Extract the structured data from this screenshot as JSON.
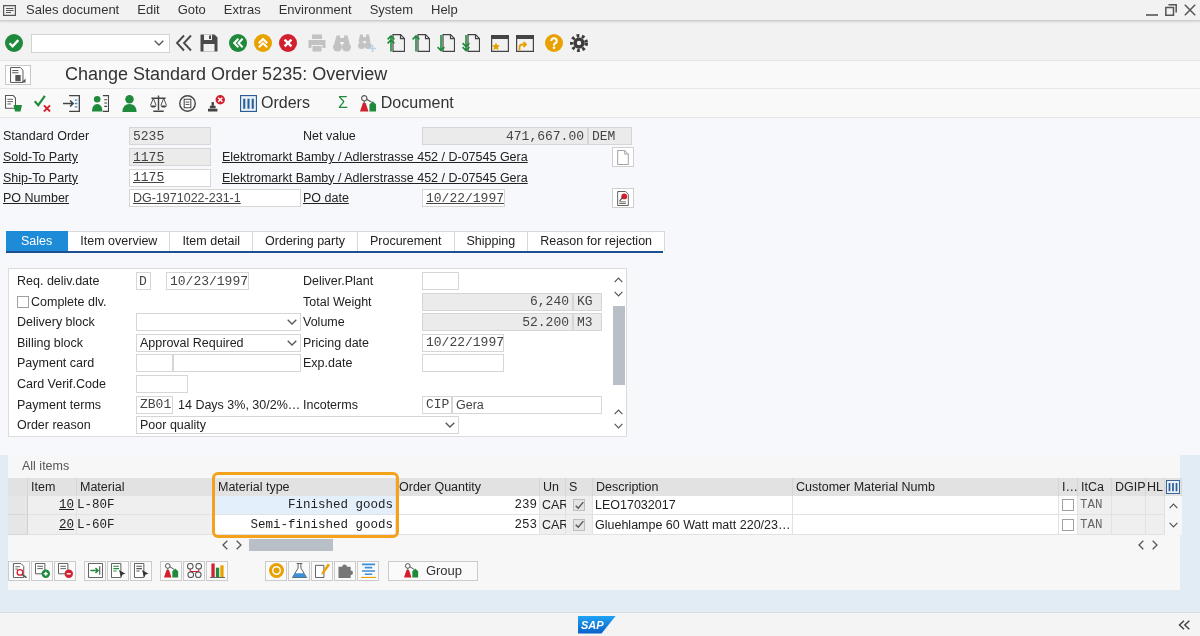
{
  "menu_bar": [
    "Sales document",
    "Edit",
    "Goto",
    "Extras",
    "Environment",
    "System",
    "Help"
  ],
  "system_toolbar": [
    {
      "kind": "enter",
      "disabled": false
    },
    {
      "kind": "collapse",
      "disabled": false
    },
    {
      "kind": "save",
      "disabled": false
    },
    {
      "kind": "back",
      "disabled": false
    },
    {
      "kind": "exit",
      "disabled": false
    },
    {
      "kind": "cancel",
      "disabled": false
    },
    {
      "kind": "print",
      "disabled": true
    },
    {
      "kind": "find",
      "disabled": true
    },
    {
      "kind": "find-next",
      "disabled": true
    },
    {
      "kind": "first-page",
      "disabled": false
    },
    {
      "kind": "previous-page",
      "disabled": false
    },
    {
      "kind": "next-page",
      "disabled": false
    },
    {
      "kind": "last-page",
      "disabled": false
    },
    {
      "kind": "new-session",
      "disabled": false
    },
    {
      "kind": "shortcut",
      "disabled": false
    },
    {
      "kind": "help",
      "disabled": false
    },
    {
      "kind": "customize",
      "disabled": false
    }
  ],
  "title": "Change Standard Order 5235: Overview",
  "application_toolbar": {
    "buttons": [
      {
        "label": "Orders"
      },
      {
        "label": "Σ"
      },
      {
        "label": "Document"
      }
    ]
  },
  "header": [
    {
      "label": "Standard Order",
      "link": false,
      "value": "5235",
      "readonly": true
    },
    {
      "label": "Net value",
      "link": false,
      "value": "471,667.00",
      "unit": "DEM",
      "readonly": true
    },
    {
      "label": "Sold-To Party",
      "link": true,
      "value": "1175",
      "readonly": true,
      "description": "Elektromarkt Bamby / Adlerstrasse 452 / D-07545 Gera"
    },
    {
      "label": "Ship-To Party",
      "link": true,
      "value": "1175",
      "readonly": false,
      "description": "Elektromarkt Bamby / Adlerstrasse 452 / D-07545 Gera"
    },
    {
      "label": "PO Number",
      "link": true,
      "value": "DG-1971022-231-1",
      "readonly": false
    },
    {
      "label": "PO date",
      "link": true,
      "value": "10/22/1997",
      "readonly": false
    }
  ],
  "tabs": [
    {
      "label": "Sales",
      "selected": true
    },
    {
      "label": "Item overview",
      "selected": false
    },
    {
      "label": "Item detail",
      "selected": false
    },
    {
      "label": "Ordering party",
      "selected": false
    },
    {
      "label": "Procurement",
      "selected": false
    },
    {
      "label": "Shipping",
      "selected": false
    },
    {
      "label": "Reason for rejection",
      "selected": false
    }
  ],
  "sales_tab": {
    "left": [
      {
        "label": "Req. deliv.date",
        "values": [
          "D",
          "10/23/1997"
        ],
        "readonly": false
      },
      {
        "label": "Complete dlv.",
        "checked": false
      },
      {
        "label": "Delivery block",
        "readonly": false
      },
      {
        "label": "Billing block",
        "value": "Approval Required",
        "readonly": false
      },
      {
        "label": "Payment card",
        "readonly": false
      },
      {
        "label": "Card Verif.Code",
        "readonly": false
      },
      {
        "label": "Payment terms",
        "values": [
          "ZB01",
          "14 Days 3%, 30/2%…"
        ],
        "readonly": false
      },
      {
        "label": "Order reason",
        "value": "Poor quality",
        "readonly": false
      }
    ],
    "right": [
      {
        "label": "Deliver.Plant",
        "readonly": false
      },
      {
        "label": "Total Weight",
        "value": "6,240",
        "unit": "KG",
        "readonly": true
      },
      {
        "label": "Volume",
        "value": "52.200",
        "unit": "M3",
        "readonly": true
      },
      {
        "label": "Pricing date",
        "value": "10/22/1997",
        "readonly": false
      },
      {
        "label": "Exp.date",
        "readonly": false
      },
      {
        "label": "Incoterms",
        "values": [
          "CIP",
          "Gera"
        ],
        "readonly": false
      }
    ]
  },
  "items": {
    "title": "All items",
    "columns": [
      {
        "label": "Item",
        "editable": false,
        "highlighted": false
      },
      {
        "label": "Material",
        "editable": false,
        "highlighted": false
      },
      {
        "label": "Material type",
        "editable": true,
        "highlighted": true
      },
      {
        "label": "Order Quantity",
        "editable": true,
        "highlighted": false
      },
      {
        "label": "Un",
        "editable": false,
        "highlighted": false
      },
      {
        "label": "S",
        "editable": false,
        "highlighted": false
      },
      {
        "label": "Description",
        "editable": true,
        "highlighted": false
      },
      {
        "label": "Customer Material Numb",
        "editable": true,
        "highlighted": false
      },
      {
        "label": "I…",
        "editable": true,
        "highlighted": false
      },
      {
        "label": "ItCa",
        "editable": false,
        "highlighted": false
      },
      {
        "label": "DGIP",
        "editable": false,
        "highlighted": false
      },
      {
        "label": "HL",
        "editable": false,
        "highlighted": false
      }
    ],
    "rows": [
      {
        "item": "10",
        "material": "L-80F",
        "material_type": "Finished goods",
        "order_quantity": "239",
        "unit": "CAR",
        "s_checked": true,
        "description": "LEO17032017",
        "i_checked": false,
        "itca": "TAN",
        "focused": true
      },
      {
        "item": "20",
        "material": "L-60F",
        "material_type": "Semi-finished goods",
        "order_quantity": "253",
        "unit": "CAR",
        "s_checked": true,
        "description": "Gluehlampe 60 Watt matt 220/23…",
        "i_checked": false,
        "itca": "TAN",
        "focused": false
      }
    ]
  },
  "items_toolbar": {
    "buttons": [
      {
        "label": "Group"
      }
    ]
  },
  "status_bar": {
    "logo": "SAP"
  }
}
